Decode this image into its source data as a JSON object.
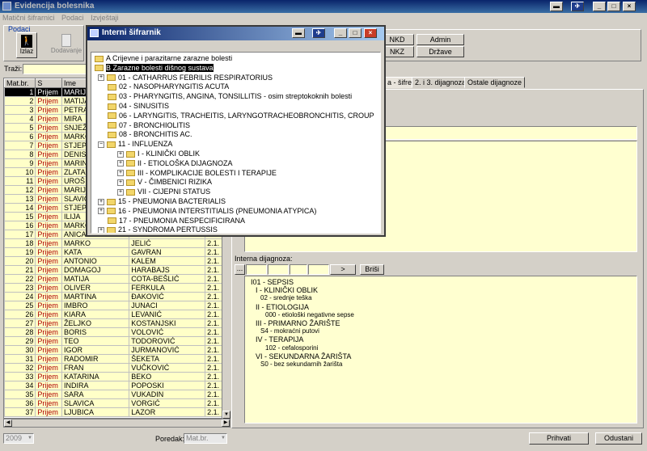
{
  "app": {
    "title": "Evidencija bolesnika"
  },
  "menu": [
    "Matični šifrarnici",
    "Podaci",
    "Izvještaji"
  ],
  "podaci": {
    "label": "Podaci",
    "izlaz": "Izlaz",
    "dodavanje": "Dodavanje"
  },
  "codes": {
    "nkd": "NKD",
    "admin": "Admin",
    "nkz": "NKZ",
    "drzave": "Države"
  },
  "search": {
    "label": "Traži:"
  },
  "grid": {
    "headers": [
      "Mat.br.",
      "S",
      "Ime",
      "",
      ""
    ],
    "rows": [
      {
        "nr": "1",
        "s": "Prijem",
        "ime": "MARIJA",
        "pre": "",
        "dt": "",
        "selected": true
      },
      {
        "nr": "2",
        "s": "Prijem",
        "ime": "MATIJA",
        "pre": "",
        "dt": ""
      },
      {
        "nr": "3",
        "s": "Prijem",
        "ime": "PETRA",
        "pre": "",
        "dt": ""
      },
      {
        "nr": "4",
        "s": "Prijem",
        "ime": "MIRA",
        "pre": "",
        "dt": ""
      },
      {
        "nr": "5",
        "s": "Prijem",
        "ime": "SNJEŽANA",
        "pre": "",
        "dt": ""
      },
      {
        "nr": "6",
        "s": "Prijem",
        "ime": "MARKO",
        "pre": "",
        "dt": ""
      },
      {
        "nr": "7",
        "s": "Prijem",
        "ime": "STJEPKO",
        "pre": "",
        "dt": ""
      },
      {
        "nr": "8",
        "s": "Prijem",
        "ime": "DENIS",
        "pre": "",
        "dt": ""
      },
      {
        "nr": "9",
        "s": "Prijem",
        "ime": "MARINA",
        "pre": "",
        "dt": ""
      },
      {
        "nr": "10",
        "s": "Prijem",
        "ime": "ZLATA",
        "pre": "",
        "dt": ""
      },
      {
        "nr": "11",
        "s": "Prijem",
        "ime": "UROŠ",
        "pre": "",
        "dt": ""
      },
      {
        "nr": "12",
        "s": "Prijem",
        "ime": "MARIJA",
        "pre": "",
        "dt": ""
      },
      {
        "nr": "13",
        "s": "Prijem",
        "ime": "SLAVICA",
        "pre": "",
        "dt": ""
      },
      {
        "nr": "14",
        "s": "Prijem",
        "ime": "STJEPAN",
        "pre": "",
        "dt": ""
      },
      {
        "nr": "15",
        "s": "Prijem",
        "ime": "ILIJA",
        "pre": "",
        "dt": ""
      },
      {
        "nr": "16",
        "s": "Prijem",
        "ime": "MARKO",
        "pre": "",
        "dt": ""
      },
      {
        "nr": "17",
        "s": "Prijem",
        "ime": "ANICA",
        "pre": "",
        "dt": ""
      },
      {
        "nr": "18",
        "s": "Prijem",
        "ime": "MARKO",
        "pre": "JELIĆ",
        "dt": "2.1."
      },
      {
        "nr": "19",
        "s": "Prijem",
        "ime": "KATA",
        "pre": "GAVRAN",
        "dt": "2.1."
      },
      {
        "nr": "20",
        "s": "Prijem",
        "ime": "ANTONIO",
        "pre": "KALEM",
        "dt": "2.1."
      },
      {
        "nr": "21",
        "s": "Prijem",
        "ime": "DOMAGOJ",
        "pre": "HARABAJS",
        "dt": "2.1."
      },
      {
        "nr": "22",
        "s": "Prijem",
        "ime": "MATIJA",
        "pre": "COTA-BEŠLIĆ",
        "dt": "2.1."
      },
      {
        "nr": "23",
        "s": "Prijem",
        "ime": "OLIVER",
        "pre": "FERKULA",
        "dt": "2.1."
      },
      {
        "nr": "24",
        "s": "Prijem",
        "ime": "MARTINA",
        "pre": "ĐAKOVIĆ",
        "dt": "2.1."
      },
      {
        "nr": "25",
        "s": "Prijem",
        "ime": "IMBRO",
        "pre": "JUNACI",
        "dt": "2.1."
      },
      {
        "nr": "26",
        "s": "Prijem",
        "ime": "KIARA",
        "pre": "LEVANIĆ",
        "dt": "2.1."
      },
      {
        "nr": "27",
        "s": "Prijem",
        "ime": "ŽELJKO",
        "pre": "KOSTANJSKI",
        "dt": "2.1."
      },
      {
        "nr": "28",
        "s": "Prijem",
        "ime": "BORIS",
        "pre": "VOLOVIĆ",
        "dt": "2.1."
      },
      {
        "nr": "29",
        "s": "Prijem",
        "ime": "TEO",
        "pre": "TODOROVIĆ",
        "dt": "2.1."
      },
      {
        "nr": "30",
        "s": "Prijem",
        "ime": "IGOR",
        "pre": "JURMANOVIĆ",
        "dt": "2.1."
      },
      {
        "nr": "31",
        "s": "Prijem",
        "ime": "RADOMIR",
        "pre": "ŠEKETA",
        "dt": "2.1."
      },
      {
        "nr": "32",
        "s": "Prijem",
        "ime": "FRAN",
        "pre": "VUČKOVIĆ",
        "dt": "2.1."
      },
      {
        "nr": "33",
        "s": "Prijem",
        "ime": "KATARINA",
        "pre": "BEKO",
        "dt": "2.1."
      },
      {
        "nr": "34",
        "s": "Prijem",
        "ime": "INDIRA",
        "pre": "POPOSKI",
        "dt": "2.1."
      },
      {
        "nr": "35",
        "s": "Prijem",
        "ime": "SARA",
        "pre": "VUKADIN",
        "dt": "2.1."
      },
      {
        "nr": "36",
        "s": "Prijem",
        "ime": "SLAVICA",
        "pre": "VORGIĆ",
        "dt": "2.1."
      },
      {
        "nr": "37",
        "s": "Prijem",
        "ime": "LJUBICA",
        "pre": "LAZOR",
        "dt": "2.1."
      }
    ]
  },
  "footer": {
    "year": "2009",
    "poredak_label": "Poredak:",
    "poredak_value": "Mat.br.",
    "prihvati": "Prihvati",
    "odustani": "Odustani"
  },
  "tabs": [
    "a - šifre",
    "2. i 3. dijagnoza",
    "Ostale dijagnoze"
  ],
  "interna": {
    "label": "Interna dijagnoza:",
    "nav": "...",
    "next": ">",
    "brisi": "Briši"
  },
  "diagnosis_lines": [
    "I01 - SEPSIS",
    "I - KLINIČKI OBLIK",
    "02 - srednje teška",
    "II - ETIOLOGIJA",
    "000 - etiološki negativne sepse",
    "III - PRIMARNO ŽARIŠTE",
    "S4 - mokraćni putovi",
    "IV - TERAPIJA",
    "102 - cefalosporini",
    "VI - SEKUNDARNA ŽARIŠTA",
    "S0 - bez sekundarnih žarišta"
  ],
  "dialog": {
    "title": "Interni šifrarnik",
    "items": [
      "A Crijevne i parazitarne zarazne bolesti",
      "B Zarazne bolesti dišnog sustava",
      "01 - CATHARRUS FEBRILIS RESPIRATORIUS",
      "02 - NASOPHARYNGITIS ACUTA",
      "03 - PHARYNGITIS, ANGINA, TONSILLITIS - osim streptokoknih bolesti",
      "04 - SINUSITIS",
      "06 - LARYNGITIS, TRACHEITIS, LARYNGOTRACHEOBRONCHITIS, CROUP",
      "07 - BRONCHIOLITIS",
      "08 - BRONCHITIS AC.",
      "11 - INFLUENZA",
      "I - KLINIČKI OBLIK",
      "II - ETIOLOŠKA DIJAGNOZA",
      "III - KOMPLIKACIJE BOLESTI I TERAPIJE",
      "V - ČIMBENICI RIZIKA",
      "VII - CIJEPNI STATUS",
      "15 - PNEUMONIA BACTERIALIS",
      "16 - PNEUMONIA INTERSTITIALIS   (PNEUMONIA ATYPICA)",
      "17 - PNEUMONIA NESPECIFICIRANA",
      "21 - SYNDROMA PERTUSSIS"
    ]
  },
  "colors": {
    "titlebar": "#0a246a",
    "selected_row": "#000000",
    "grid_yellow": "#ffffc8",
    "status_red": "#b00000"
  }
}
